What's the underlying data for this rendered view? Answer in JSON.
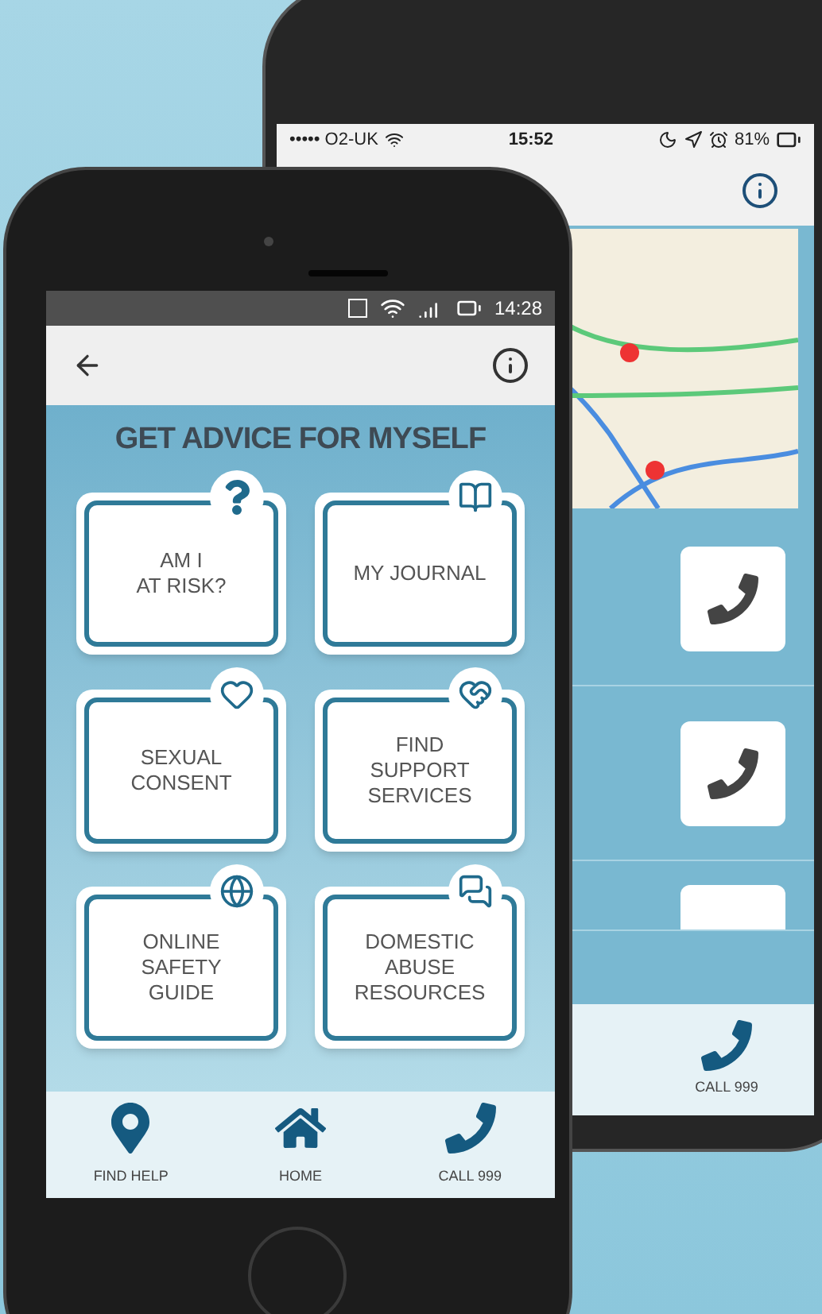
{
  "back_phone": {
    "status_bar": {
      "carrier": "••••• O2-UK",
      "time": "15:52",
      "battery": "81%"
    },
    "nav": [
      {
        "label": "CALL 999",
        "kind": "phone"
      }
    ]
  },
  "front_phone": {
    "status_bar": {
      "time": "14:28"
    },
    "title": "GET ADVICE FOR MYSELF",
    "tiles": [
      {
        "label": "AM I\nAT RISK?",
        "kind": "question"
      },
      {
        "label": "MY JOURNAL",
        "kind": "book"
      },
      {
        "label": "SEXUAL\nCONSENT",
        "kind": "heart"
      },
      {
        "label": "FIND\nSUPPORT\nSERVICES",
        "kind": "handshake"
      },
      {
        "label": "ONLINE\nSAFETY\nGUIDE",
        "kind": "globe"
      },
      {
        "label": "DOMESTIC\nABUSE\nRESOURCES",
        "kind": "chat"
      }
    ],
    "nav": [
      {
        "label": "FIND HELP",
        "kind": "pin"
      },
      {
        "label": "HOME",
        "kind": "home"
      },
      {
        "label": "CALL 999",
        "kind": "phone"
      }
    ]
  }
}
